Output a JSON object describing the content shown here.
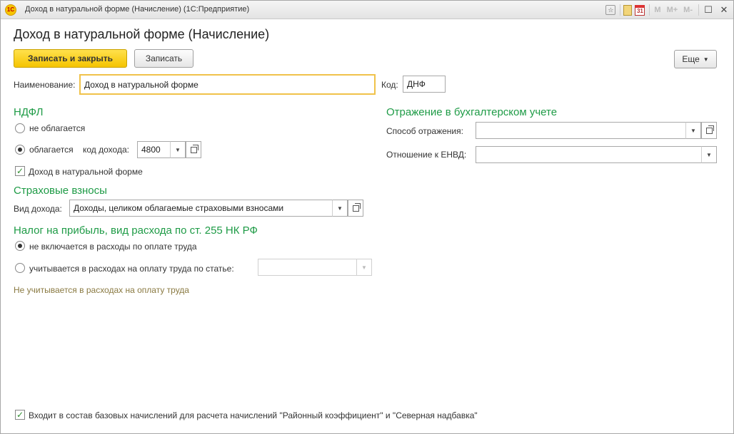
{
  "window": {
    "title": "Доход в натуральной форме (Начисление)  (1С:Предприятие)",
    "logo_text": "1С"
  },
  "titlebar_tools": {
    "m": "M",
    "m_plus": "M+",
    "m_minus": "M-",
    "calendar_day": "31"
  },
  "form": {
    "title": "Доход в натуральной форме (Начисление)",
    "btn_save_close": "Записать и закрыть",
    "btn_save": "Записать",
    "btn_more": "Еще"
  },
  "fields": {
    "name_label": "Наименование:",
    "name_value": "Доход в натуральной форме",
    "code_label": "Код:",
    "code_value": "ДНФ"
  },
  "ndfl": {
    "heading": "НДФЛ",
    "opt_not_taxed": "не облагается",
    "opt_taxed": "облагается",
    "income_code_label": "код дохода:",
    "income_code_value": "4800",
    "selected": "taxed",
    "natural_form_label": "Доход в натуральной форме",
    "natural_form_checked": true
  },
  "insurance": {
    "heading": "Страховые взносы",
    "income_type_label": "Вид дохода:",
    "income_type_value": "Доходы, целиком облагаемые страховыми взносами"
  },
  "profit_tax": {
    "heading": "Налог на прибыль, вид расхода по ст. 255 НК РФ",
    "opt_not_included": "не включается в расходы по оплате труда",
    "opt_included": "учитывается в расходах на оплату труда по статье:",
    "selected": "not_included",
    "note": "Не учитывается в расходах на оплату труда"
  },
  "accounting": {
    "heading": "Отражение в бухгалтерском учете",
    "method_label": "Способ отражения:",
    "method_value": "",
    "envd_label": "Отношение к ЕНВД:",
    "envd_value": ""
  },
  "footer": {
    "base_charges_label": "Входит в состав базовых начислений для расчета начислений \"Районный коэффициент\" и \"Северная надбавка\"",
    "base_charges_checked": true
  }
}
